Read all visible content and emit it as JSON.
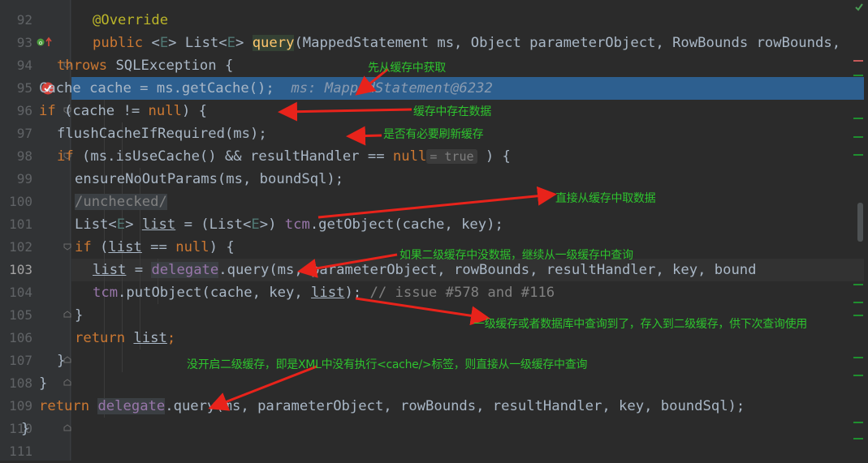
{
  "lines": [
    {
      "num": "92"
    },
    {
      "num": "93"
    },
    {
      "num": "94"
    },
    {
      "num": "95"
    },
    {
      "num": "96"
    },
    {
      "num": "97"
    },
    {
      "num": "98"
    },
    {
      "num": "99"
    },
    {
      "num": "100"
    },
    {
      "num": "101"
    },
    {
      "num": "102"
    },
    {
      "num": "103"
    },
    {
      "num": "104"
    },
    {
      "num": "105"
    },
    {
      "num": "106"
    },
    {
      "num": "107"
    },
    {
      "num": "108"
    },
    {
      "num": "109"
    },
    {
      "num": "110"
    },
    {
      "num": "111"
    }
  ],
  "code": {
    "l92": {
      "ann": "@Override"
    },
    "l93": {
      "kw": "public",
      "lt": "<",
      "e1": "E",
      "gt": ">",
      "list": " List<",
      "e2": "E",
      "gt2": "> ",
      "fn": "query",
      "rest": "(MappedStatement ms, Object parameterObject, RowBounds rowBounds,"
    },
    "l94": {
      "kw": "throws",
      "rest": " SQLException {"
    },
    "l95": {
      "text": "Cache cache = ms.getCache();",
      "debug": "ms: MappedStatement@6232"
    },
    "l96": {
      "kw": "if",
      "a": " (cache != ",
      "null": "null",
      "b": ") {"
    },
    "l97": {
      "text": "flushCacheIfRequired(ms);"
    },
    "l98": {
      "kw": "if",
      "a": " (ms.isUseCache() && resultHandler == ",
      "null": "null",
      "inlay": "= true",
      "b": " ) {"
    },
    "l99": {
      "text": "ensureNoOutParams(ms, boundSql);"
    },
    "l100": {
      "cmt": "/unchecked/"
    },
    "l101": {
      "a": "List<",
      "e": "E",
      "b": "> ",
      "var": "list",
      "c": " = (List<",
      "e2": "E",
      "d": ">) ",
      "fld": "tcm",
      "f": ".getObject(cache, key);"
    },
    "l102": {
      "kw": "if",
      "a": " (",
      "var": "list",
      "b": " == ",
      "null": "null",
      "c": ") {"
    },
    "l103": {
      "var": "list",
      "a": " = ",
      "dlg": "delegate",
      "b": ".query(ms, parameterObject, rowBounds, resultHandler, key, bound"
    },
    "l104": {
      "fld": "tcm",
      "a": ".putObject(cache, key, ",
      "var": "list",
      "b": "); ",
      "cmt": "// issue #578 and #116"
    },
    "l105": {
      "text": "}"
    },
    "l106": {
      "kw": "return",
      "sp": " ",
      "var": "list",
      "semi": ";"
    },
    "l107": {
      "text": "}"
    },
    "l108": {
      "text": "}"
    },
    "l109": {
      "kw": "return",
      "sp": " ",
      "dlg": "delegate",
      "a": ".query(ms, parameterObject, rowBounds, resultHandler, key, boundSql);"
    },
    "l110": {
      "text": "}"
    },
    "l111": {
      "text": ""
    }
  },
  "annotations": {
    "n1": "先从缓存中获取",
    "n2": "缓存中存在数据",
    "n3": "是否有必要刷新缓存",
    "n4": "直接从缓存中取数据",
    "n5": "如果二级缓存中没数据，继续从一级缓存中查询",
    "n6": "一级缓存或者数据库中查询到了，存入到二级缓存，供下次查询使用",
    "n7": "没开启二级缓存，即是XML中没有执行<cache/>标签，则直接从一级缓存中查询"
  },
  "colors": {
    "annotation_text": "#2ec32e",
    "arrow": "#e8231b",
    "highlight_row": "#2d5f8f"
  }
}
